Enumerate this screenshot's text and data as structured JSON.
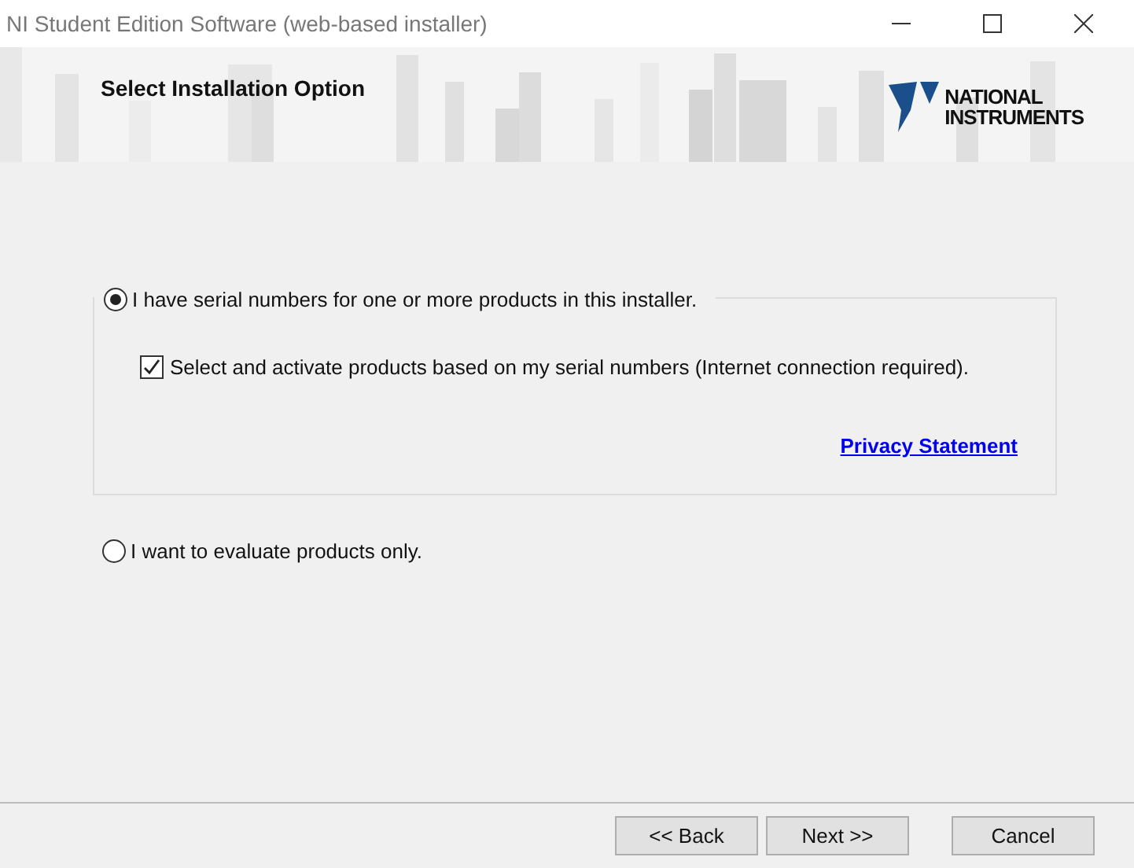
{
  "window": {
    "title": "NI Student Edition Software (web-based installer)"
  },
  "header": {
    "heading": "Select Installation Option",
    "logo": [
      "NATIONAL",
      "INSTRUMENTS"
    ]
  },
  "options": [
    {
      "label": "I have serial numbers for one or more products in this installer.",
      "selected": true,
      "checkbox": {
        "label": "Select and activate products based on my serial numbers (Internet connection required).",
        "checked": true
      },
      "link": "Privacy Statement"
    },
    {
      "label": "I want to evaluate products only.",
      "selected": false
    }
  ],
  "buttons": [
    "<< Back",
    "Next >>",
    "Cancel"
  ]
}
